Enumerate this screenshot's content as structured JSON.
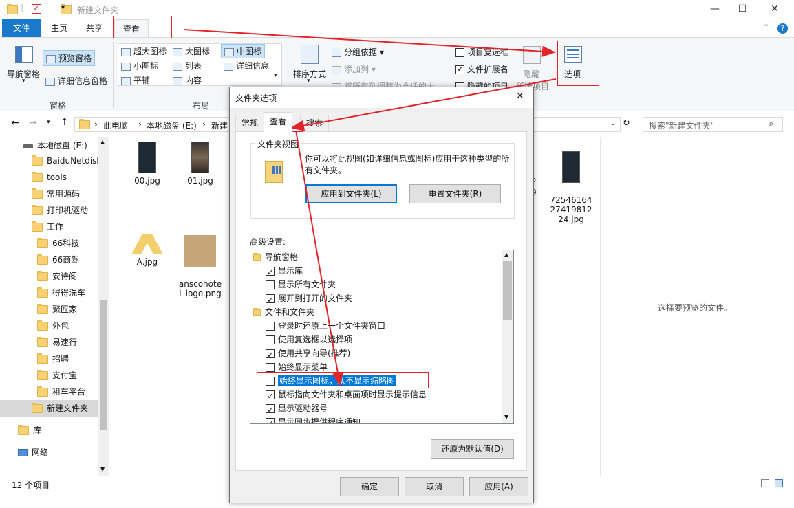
{
  "window": {
    "title": "新建文件夹",
    "controls": [
      "minimize",
      "maximize",
      "close"
    ]
  },
  "ribbon": {
    "tabs": [
      "文件",
      "主页",
      "共享",
      "查看"
    ],
    "panes": {
      "nav_pane": "导航窗格",
      "preview_pane": "预览窗格",
      "details_pane": "详细信息窗格",
      "group_title": "窗格"
    },
    "layout": {
      "items": [
        "超大图标",
        "大图标",
        "中图标",
        "小图标",
        "列表",
        "详细信息",
        "平铺",
        "内容"
      ],
      "group_title": "布局"
    },
    "current_view": {
      "sort_by": "排序方式",
      "group_by": "分组依据",
      "add_column": "添加列",
      "fit_columns": "将所有列调整为合适的大小"
    },
    "show_hide": {
      "item_checkboxes": "项目复选框",
      "file_extensions": "文件扩展名",
      "hidden_items": "隐藏的项目",
      "hide": "隐藏",
      "selected_items": "所选项目"
    },
    "options": "选项"
  },
  "address": {
    "path": [
      "此电脑",
      "本地磁盘 (E:)",
      "新建"
    ],
    "search_placeholder": "搜索\"新建文件夹\""
  },
  "nav": {
    "items": [
      "本地磁盘 (E:)",
      "BaiduNetdisk",
      "tools",
      "常用源码",
      "打印机驱动",
      "工作",
      "66科技",
      "66商驾",
      "安诗阁",
      "得得洗车",
      "聚匠家",
      "外包",
      "易速行",
      "招聘",
      "支付宝",
      "租车平台",
      "新建文件夹",
      "库",
      "网络"
    ]
  },
  "files": [
    {
      "name": "00.jpg"
    },
    {
      "name": "01.jpg"
    },
    {
      "name": "A.jpg"
    },
    {
      "name": "anscohote\nl_logo.png"
    },
    {
      "name": "72546164\n27419812\n24.jpg"
    },
    {
      "name": "2\n9"
    }
  ],
  "preview_text": "选择要预览的文件。",
  "status": {
    "count": "12 个项目"
  },
  "dialog": {
    "title": "文件夹选项",
    "tabs": [
      "常规",
      "查看",
      "搜索"
    ],
    "folder_views_title": "文件夹视图",
    "folder_views_desc": "你可以将此视图(如详细信息或图标)应用于这种类型的所有文件夹。",
    "apply_to_folders": "应用到文件夹(L)",
    "reset_folders": "重置文件夹(R)",
    "advanced_title": "高级设置:",
    "tree": [
      {
        "label": "导航窗格",
        "type": "folder"
      },
      {
        "label": "显示库",
        "checked": true
      },
      {
        "label": "显示所有文件夹",
        "checked": false
      },
      {
        "label": "展开到打开的文件夹",
        "checked": true
      },
      {
        "label": "文件和文件夹",
        "type": "folder"
      },
      {
        "label": "登录时还原上一个文件夹窗口",
        "checked": false
      },
      {
        "label": "使用复选框以选择项",
        "checked": false
      },
      {
        "label": "使用共享向导(推荐)",
        "checked": true
      },
      {
        "label": "始终显示菜单",
        "checked": false
      },
      {
        "label": "始终显示图标，从不显示缩略图",
        "checked": false,
        "selected": true
      },
      {
        "label": "鼠标指向文件夹和桌面项时显示提示信息",
        "checked": true
      },
      {
        "label": "显示驱动器号",
        "checked": true
      },
      {
        "label": "显示同步提供程序通知",
        "checked": true
      }
    ],
    "restore_defaults": "还原为默认值(D)",
    "ok": "确定",
    "cancel": "取消",
    "apply": "应用(A)"
  },
  "colors": {
    "file_tab": "#1979ca",
    "annotation": "#e3242b",
    "selection": "#0078d7"
  }
}
